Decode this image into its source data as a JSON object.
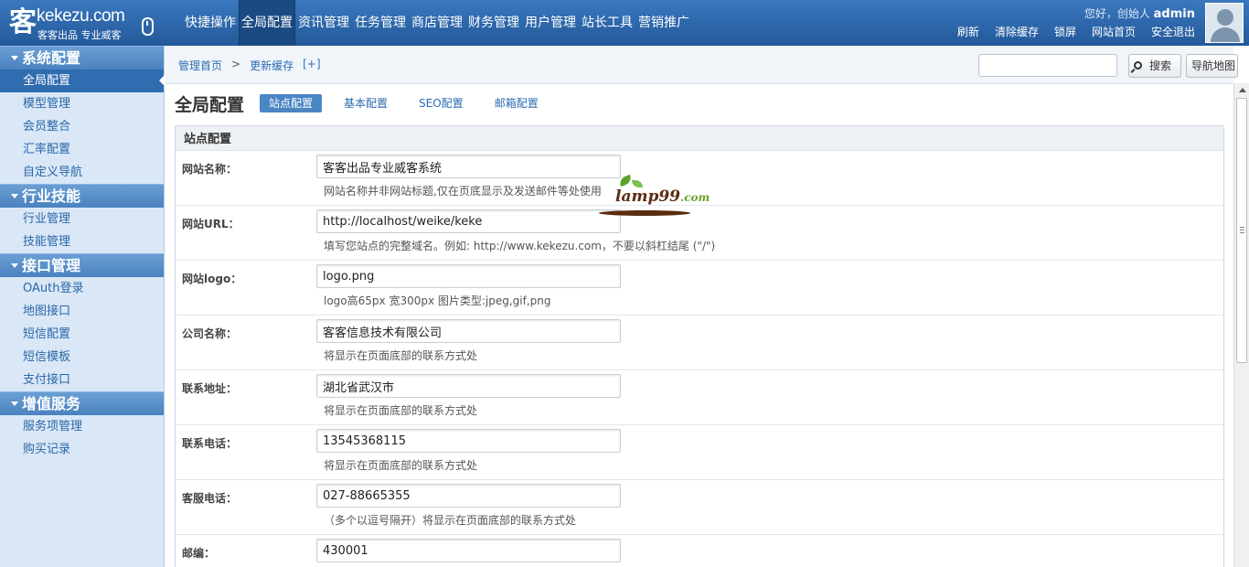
{
  "logo": {
    "brand": "kekezu.com",
    "slogan": "客客出品 专业威客",
    "seal": "客"
  },
  "top_nav": [
    {
      "label": "快捷操作",
      "active": false
    },
    {
      "label": "全局配置",
      "active": true
    },
    {
      "label": "资讯管理",
      "active": false
    },
    {
      "label": "任务管理",
      "active": false
    },
    {
      "label": "商店管理",
      "active": false
    },
    {
      "label": "财务管理",
      "active": false
    },
    {
      "label": "用户管理",
      "active": false
    },
    {
      "label": "站长工具",
      "active": false
    },
    {
      "label": "营销推广",
      "active": false
    }
  ],
  "user": {
    "greeting": "您好，创始人",
    "name": "admin",
    "links": [
      "刷新",
      "清除缓存",
      "锁屏",
      "网站首页",
      "安全退出"
    ]
  },
  "sidebar": {
    "groups": [
      {
        "title": "系统配置",
        "items": [
          {
            "label": "全局配置",
            "active": true
          },
          {
            "label": "模型管理"
          },
          {
            "label": "会员整合"
          },
          {
            "label": "汇率配置"
          },
          {
            "label": "自定义导航"
          }
        ]
      },
      {
        "title": "行业技能",
        "items": [
          {
            "label": "行业管理"
          },
          {
            "label": "技能管理"
          }
        ]
      },
      {
        "title": "接口管理",
        "items": [
          {
            "label": "OAuth登录"
          },
          {
            "label": "地图接口"
          },
          {
            "label": "短信配置"
          },
          {
            "label": "短信模板"
          },
          {
            "label": "支付接口"
          }
        ]
      },
      {
        "title": "增值服务",
        "items": [
          {
            "label": "服务项管理"
          },
          {
            "label": "购买记录"
          }
        ]
      }
    ]
  },
  "breadcrumb": {
    "home": "管理首页",
    "sep": ">",
    "current": "更新缓存",
    "add": "[+]"
  },
  "search": {
    "value": "",
    "button": "搜索",
    "map_button": "导航地图"
  },
  "page": {
    "title": "全局配置",
    "tabs": [
      {
        "label": "站点配置",
        "active": true
      },
      {
        "label": "基本配置",
        "active": false
      },
      {
        "label": "SEO配置",
        "active": false
      },
      {
        "label": "邮箱配置",
        "active": false
      }
    ]
  },
  "form": {
    "section_title": "站点配置",
    "fields": [
      {
        "label": "网站名称：",
        "value": "客客出品专业威客系统",
        "hint": "网站名称并非网站标题,仅在页底显示及发送邮件等处使用"
      },
      {
        "label": "网站URL：",
        "value": "http://localhost/weike/keke",
        "hint": "填写您站点的完整域名。例如: http://www.kekezu.com，不要以斜杠结尾 (\"/\")"
      },
      {
        "label": "网站logo：",
        "value": "logo.png",
        "hint": "logo高65px 宽300px 图片类型:jpeg,gif,png"
      },
      {
        "label": "公司名称：",
        "value": "客客信息技术有限公司",
        "hint": "将显示在页面底部的联系方式处"
      },
      {
        "label": "联系地址：",
        "value": "湖北省武汉市",
        "hint": "将显示在页面底部的联系方式处"
      },
      {
        "label": "联系电话：",
        "value": "13545368115",
        "hint": "将显示在页面底部的联系方式处"
      },
      {
        "label": "客服电话：",
        "value": "027-88665355",
        "hint": "（多个以逗号隔开）将显示在页面底部的联系方式处"
      },
      {
        "label": "邮编：",
        "value": "430001",
        "hint": ""
      }
    ]
  },
  "watermark": {
    "text": "lamp99",
    "suffix": ".com"
  },
  "colors": {
    "topbar": "#2a63a5",
    "sidebar_bg": "#d9e7f6",
    "active_item": "#2f6cb0",
    "link": "#2b6cb0"
  }
}
